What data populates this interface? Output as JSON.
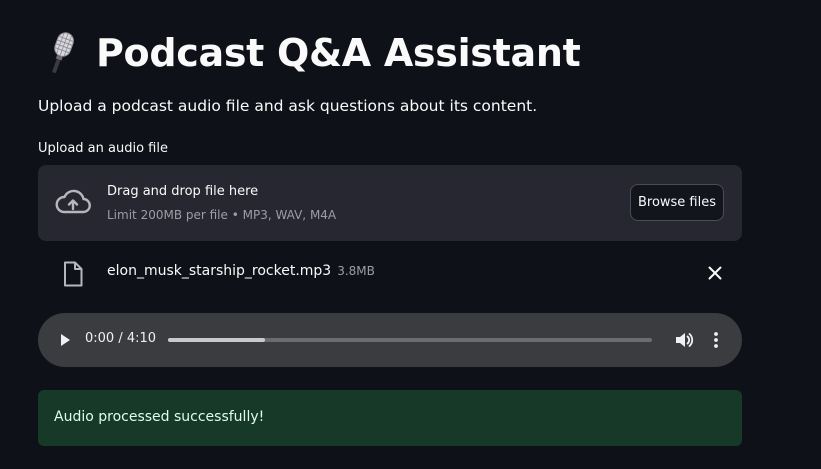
{
  "header": {
    "title": "Podcast Q&A Assistant",
    "title_icon": "microphone-icon",
    "subtitle": "Upload a podcast audio file and ask questions about its content."
  },
  "uploader": {
    "label": "Upload an audio file",
    "drop_title": "Drag and drop file here",
    "limit_text": "Limit 200MB per file • MP3, WAV, M4A",
    "browse_label": "Browse files",
    "icon": "cloud-upload-icon"
  },
  "uploaded_file": {
    "name": "elon_musk_starship_rocket.mp3",
    "size": "3.8MB",
    "icon": "file-icon",
    "remove_icon": "close-icon"
  },
  "audio_player": {
    "time_display": "0:00 / 4:10",
    "buffered_fraction": 0.2,
    "play_icon": "play-icon",
    "volume_icon": "volume-icon",
    "menu_icon": "more-vertical-icon"
  },
  "status": {
    "message": "Audio processed successfully!",
    "color": "#173928"
  },
  "colors": {
    "background": "#0e1117",
    "panel": "#262730",
    "player": "#3b3c3f"
  }
}
